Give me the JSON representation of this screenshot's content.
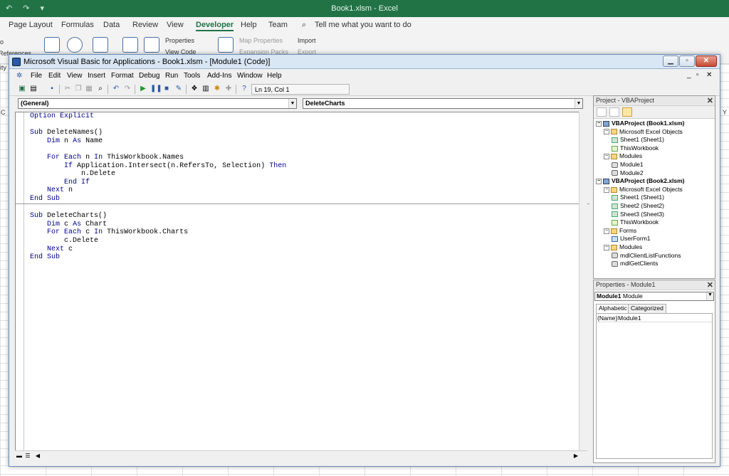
{
  "excel": {
    "title": "Book1.xlsm  -  Excel",
    "tabs": [
      "Page Layout",
      "Formulas",
      "Data",
      "Review",
      "View",
      "Developer",
      "Help",
      "Team"
    ],
    "active_tab": "Developer",
    "tell_me": "Tell me what you want to do",
    "ribbon": {
      "properties": "Properties",
      "view_code": "View Code",
      "map_properties": "Map Properties",
      "expansion_packs": "Expansion Packs",
      "import": "Import",
      "export": "Export",
      "references": "References"
    },
    "left_edge": [
      "o",
      "References",
      "ity",
      "C"
    ],
    "right_edge": "Y"
  },
  "vbe": {
    "title": "Microsoft Visual Basic for Applications - Book1.xlsm - [Module1 (Code)]",
    "menu": [
      "File",
      "Edit",
      "View",
      "Insert",
      "Format",
      "Debug",
      "Run",
      "Tools",
      "Add-Ins",
      "Window",
      "Help"
    ],
    "status": "Ln 19, Col 1",
    "general_combo": "(General)",
    "proc_combo": "DeleteCharts",
    "code": {
      "line1": "Option Explicit",
      "p1": [
        "Sub DeleteNames()",
        "    Dim n As Name",
        "",
        "    For Each n In ThisWorkbook.Names",
        "        If Application.Intersect(n.RefersTo, Selection) Then",
        "            n.Delete",
        "        End If",
        "    Next n",
        "End Sub"
      ],
      "p2": [
        "Sub DeleteCharts()",
        "    Dim c As Chart",
        "    For Each c In ThisWorkbook.Charts",
        "        c.Delete",
        "    Next c",
        "End Sub"
      ]
    }
  },
  "project": {
    "title": "Project - VBAProject",
    "nodes": [
      "VBAProject (Book1.xlsm)",
      "Microsoft Excel Objects",
      "Sheet1 (Sheet1)",
      "ThisWorkbook",
      "Modules",
      "Module1",
      "Module2",
      "VBAProject (Book2.xlsm)",
      "Microsoft Excel Objects",
      "Sheet1 (Sheet1)",
      "Sheet2 (Sheet2)",
      "Sheet3 (Sheet3)",
      "ThisWorkbook",
      "Forms",
      "UserForm1",
      "Modules",
      "mdlClientListFunctions",
      "mdlGetClients"
    ]
  },
  "properties": {
    "title": "Properties - Module1",
    "selector_name": "Module1",
    "selector_type": "Module",
    "tabs": [
      "Alphabetic",
      "Categorized"
    ],
    "row_key": "(Name)",
    "row_value": "Module1"
  }
}
